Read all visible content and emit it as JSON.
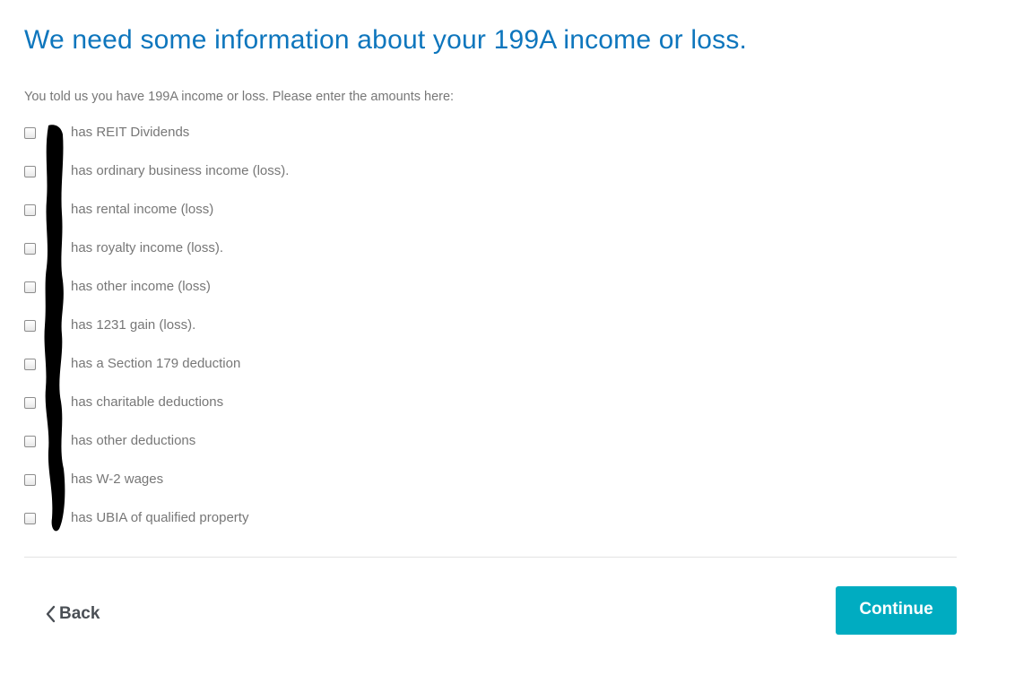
{
  "page": {
    "title": "We need some information about your 199A income or loss.",
    "intro": "You told us you have 199A income or loss. Please enter the amounts here:"
  },
  "options": [
    {
      "label": "has REIT Dividends",
      "checked": false
    },
    {
      "label": "has ordinary business income (loss).",
      "checked": false
    },
    {
      "label": "has rental income (loss)",
      "checked": false
    },
    {
      "label": "has royalty income (loss).",
      "checked": false
    },
    {
      "label": "has other income (loss)",
      "checked": false
    },
    {
      "label": "has 1231 gain (loss).",
      "checked": false
    },
    {
      "label": "has a Section 179 deduction",
      "checked": false
    },
    {
      "label": "has charitable deductions",
      "checked": false
    },
    {
      "label": "has other deductions",
      "checked": false
    },
    {
      "label": "has W-2 wages",
      "checked": false
    },
    {
      "label": "has UBIA of qualified property",
      "checked": false
    }
  ],
  "nav": {
    "back_label": "Back",
    "continue_label": "Continue"
  },
  "colors": {
    "title": "#0e76bd",
    "body_text": "#777777",
    "continue_bg": "#00acc1",
    "back_text": "#4a4f55",
    "divider": "#e3e3e3",
    "redaction": "#000000"
  },
  "icons": {
    "back": "chevron-left-icon"
  }
}
